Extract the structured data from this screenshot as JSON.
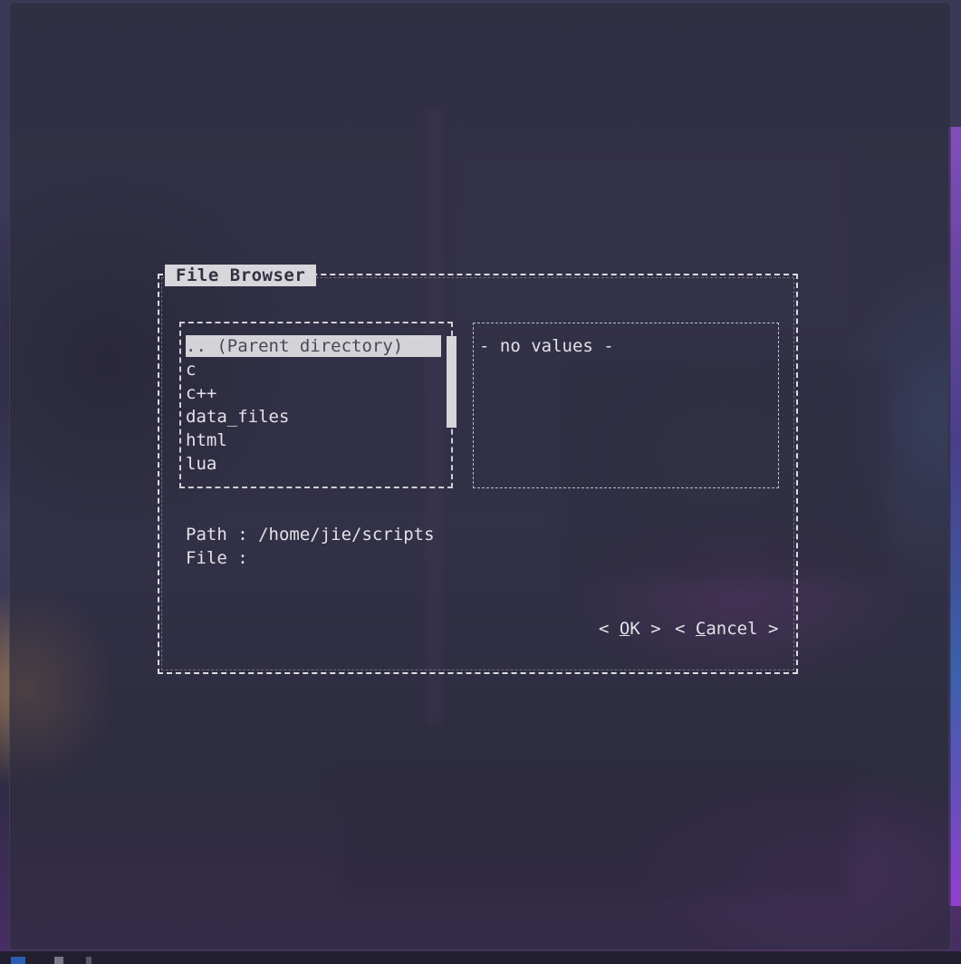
{
  "dialog": {
    "title": "File Browser",
    "list_items": [
      ".. (Parent directory)",
      "c",
      "c++",
      "data_files",
      "html",
      "lua"
    ],
    "selected_index": 0,
    "values_placeholder": "- no values -",
    "path_line": "Path : /home/jie/scripts",
    "file_line": "File :",
    "ok_button": {
      "left": "< ",
      "hotkey": "O",
      "rest": "K",
      "right": " >"
    },
    "cancel_button": {
      "left": "< ",
      "hotkey": "C",
      "rest": "ancel",
      "right": " >"
    }
  },
  "colors": {
    "accent": "#d6d6db",
    "text": "#e2e2e8",
    "overlay": "#2e2c3e"
  }
}
